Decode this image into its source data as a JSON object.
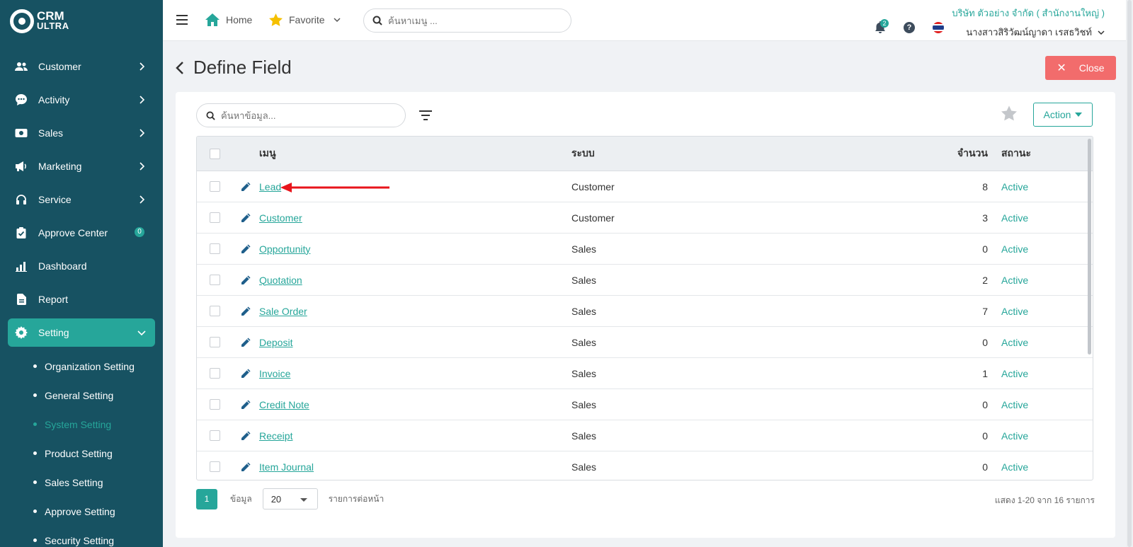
{
  "app": {
    "logo_line1": "CRM",
    "logo_line2": "ULTRA"
  },
  "sidebar": {
    "items": [
      {
        "label": "Customer",
        "icon": "users-icon"
      },
      {
        "label": "Activity",
        "icon": "chat-icon"
      },
      {
        "label": "Sales",
        "icon": "cash-icon"
      },
      {
        "label": "Marketing",
        "icon": "megaphone-icon"
      },
      {
        "label": "Service",
        "icon": "headset-icon"
      },
      {
        "label": "Approve Center",
        "icon": "check-clipboard-icon",
        "badge": "0"
      },
      {
        "label": "Dashboard",
        "icon": "bar-chart-icon"
      },
      {
        "label": "Report",
        "icon": "document-icon"
      },
      {
        "label": "Setting",
        "icon": "gear-icon",
        "active": true
      }
    ],
    "submenu": [
      {
        "label": "Organization Setting"
      },
      {
        "label": "General Setting"
      },
      {
        "label": "System Setting",
        "active": true
      },
      {
        "label": "Product Setting"
      },
      {
        "label": "Sales Setting"
      },
      {
        "label": "Approve Setting"
      },
      {
        "label": "Security Setting"
      }
    ]
  },
  "topbar": {
    "home_label": "Home",
    "favorite_label": "Favorite",
    "search_placeholder": "ค้นหาเมนู ...",
    "company": "บริษัท ตัวอย่าง จำกัด ( สำนักงานใหญ่ )",
    "user_name": "นางสาวสิริวัฒน์ญาดา เรสธวิชท์",
    "notification_count": "2",
    "help_label": "?"
  },
  "page": {
    "title": "Define Field",
    "close_label": "Close",
    "search_placeholder": "ค้นหาข้อมูล...",
    "action_label": "Action"
  },
  "table": {
    "headers": {
      "menu": "เมนู",
      "system": "ระบบ",
      "count": "จำนวน",
      "status": "สถานะ"
    },
    "rows": [
      {
        "menu": "Lead",
        "system": "Customer",
        "count": "8",
        "status": "Active"
      },
      {
        "menu": "Customer",
        "system": "Customer",
        "count": "3",
        "status": "Active"
      },
      {
        "menu": "Opportunity",
        "system": "Sales",
        "count": "0",
        "status": "Active"
      },
      {
        "menu": "Quotation",
        "system": "Sales",
        "count": "2",
        "status": "Active"
      },
      {
        "menu": "Sale Order",
        "system": "Sales",
        "count": "7",
        "status": "Active"
      },
      {
        "menu": "Deposit",
        "system": "Sales",
        "count": "0",
        "status": "Active"
      },
      {
        "menu": "Invoice",
        "system": "Sales",
        "count": "1",
        "status": "Active"
      },
      {
        "menu": "Credit Note",
        "system": "Sales",
        "count": "0",
        "status": "Active"
      },
      {
        "menu": "Receipt",
        "system": "Sales",
        "count": "0",
        "status": "Active"
      },
      {
        "menu": "Item Journal",
        "system": "Sales",
        "count": "0",
        "status": "Active"
      }
    ]
  },
  "pagination": {
    "current_page": "1",
    "data_label": "ข้อมูล",
    "page_size": "20",
    "per_page_label": "รายการต่อหน้า",
    "summary": "แสดง 1-20 จาก 16 รายการ"
  },
  "colors": {
    "sidebar_bg": "#175262",
    "accent": "#26a69a",
    "close_button": "#f26c6c",
    "annotation_arrow": "#e8141b"
  }
}
